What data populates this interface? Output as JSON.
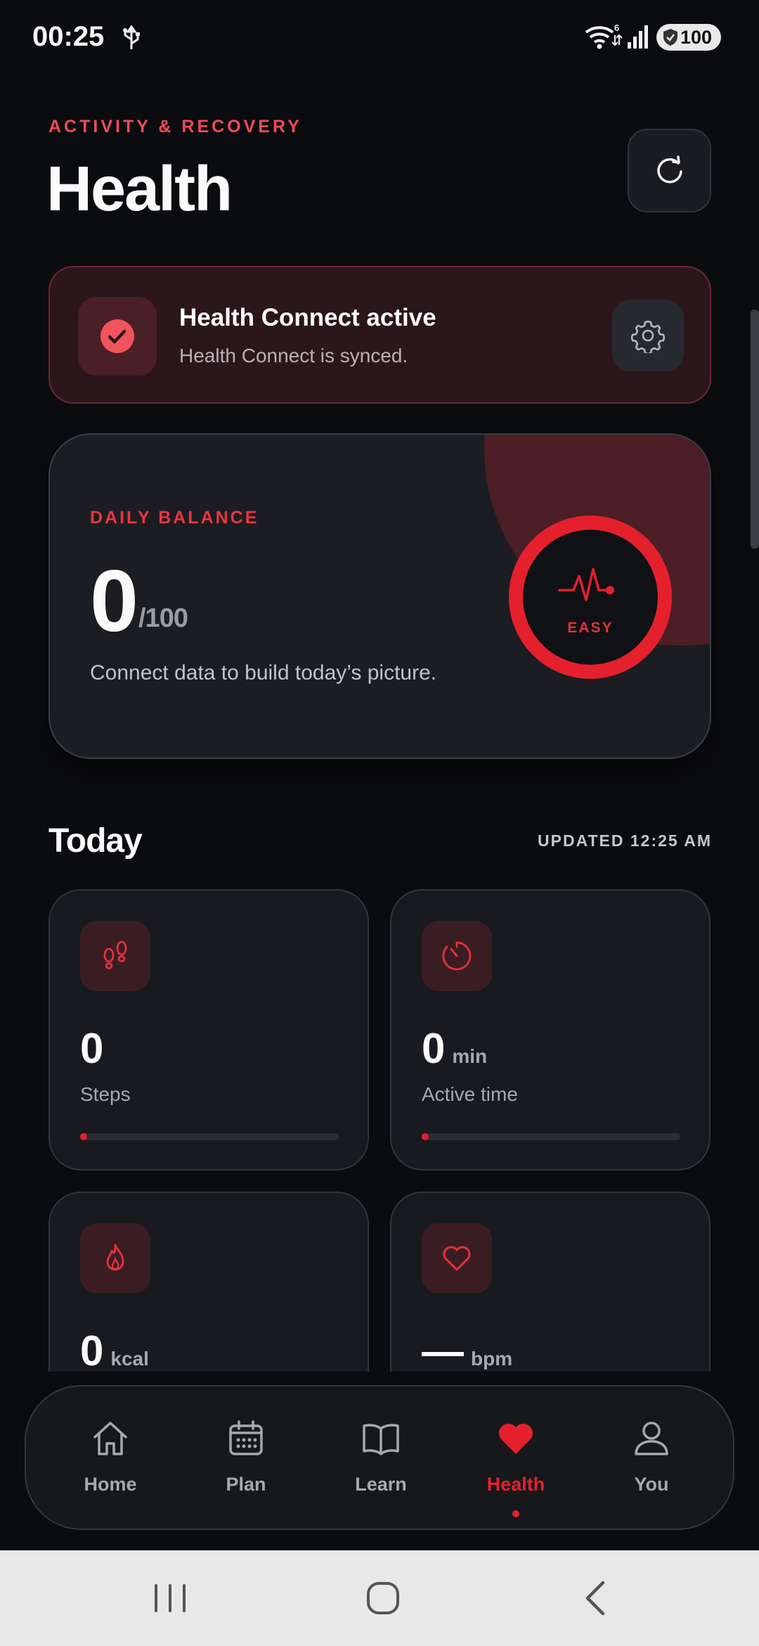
{
  "status_bar": {
    "time": "00:25",
    "wifi_badge": "6",
    "battery": "100"
  },
  "header": {
    "eyebrow": "ACTIVITY & RECOVERY",
    "title": "Health"
  },
  "health_connect": {
    "title": "Health Connect active",
    "subtitle": "Health Connect is synced."
  },
  "balance": {
    "eyebrow": "DAILY BALANCE",
    "value": "0",
    "max": "/100",
    "caption": "Connect data to build today’s picture.",
    "status_label": "EASY"
  },
  "today": {
    "title": "Today",
    "updated": "UPDATED 12:25 AM",
    "metrics": [
      {
        "value": "0",
        "unit": "",
        "label": "Steps",
        "progress": 0,
        "icon": "footprints-icon"
      },
      {
        "value": "0",
        "unit": "min",
        "label": "Active time",
        "progress": 0,
        "icon": "timer-icon"
      },
      {
        "value": "0",
        "unit": "kcal",
        "label": "",
        "progress": null,
        "icon": "flame-icon"
      },
      {
        "value": "—",
        "unit": "bpm",
        "label": "",
        "progress": null,
        "icon": "heart-icon"
      }
    ]
  },
  "nav": {
    "items": [
      {
        "label": "Home",
        "icon": "home-icon"
      },
      {
        "label": "Plan",
        "icon": "calendar-icon"
      },
      {
        "label": "Learn",
        "icon": "book-icon"
      },
      {
        "label": "Health",
        "icon": "heart-icon",
        "active": true
      },
      {
        "label": "You",
        "icon": "user-icon"
      }
    ]
  },
  "colors": {
    "accent": "#e5202d",
    "background": "#0b0c0f",
    "card": "#1c1d22"
  }
}
